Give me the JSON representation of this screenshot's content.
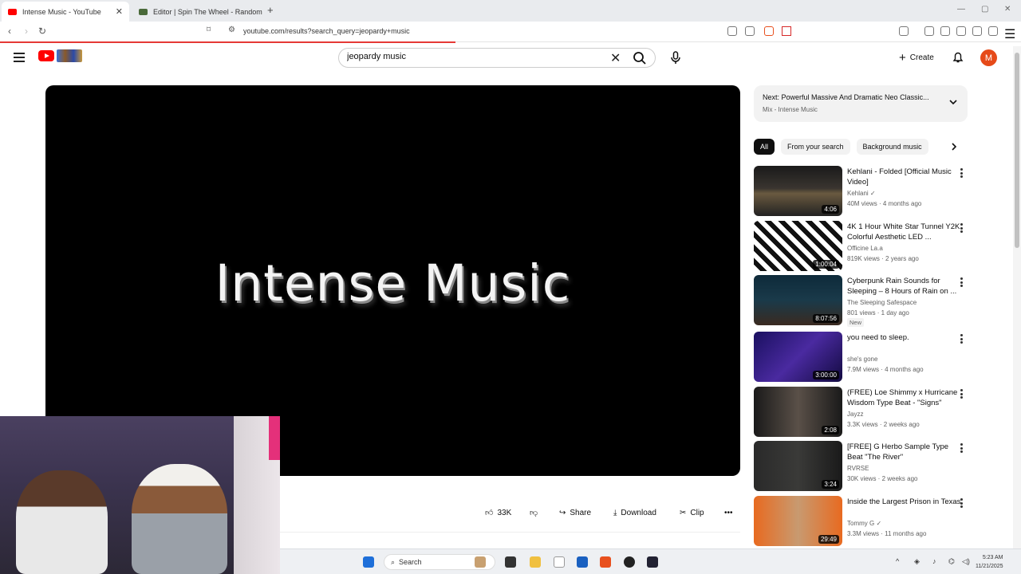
{
  "browser": {
    "tabs": [
      {
        "title": "Intense Music - YouTube",
        "active": true,
        "favicon_color": "#ff0000"
      },
      {
        "title": "Editor | Spin The Wheel - Random Pi",
        "active": false,
        "favicon_color": "#4a6a3a"
      }
    ],
    "address": "youtube.com/results?search_query=jeopardy+music"
  },
  "header": {
    "search_value": "jeopardy music",
    "create_label": "Create",
    "avatar_letter": "M"
  },
  "player": {
    "title_text": "Intense Music"
  },
  "actions": {
    "like_count": "33K",
    "share_label": "Share",
    "download_label": "Download",
    "clip_label": "Clip"
  },
  "next_up": {
    "title": "Next: Powerful Massive And Dramatic Neo Classic...",
    "subtitle": "Mix - Intense Music"
  },
  "chips": [
    "All",
    "From your search",
    "Background music"
  ],
  "recommendations": [
    {
      "title": "Kehlani - Folded [Official Music Video]",
      "channel": "Kehlani",
      "verified": true,
      "meta": "40M views · 4 months ago",
      "duration": "4:06",
      "badge": "",
      "thumb": "linear-gradient(180deg,#1a1a1a 0%,#3a3530 45%,#6a5a40 55%,#222 100%)"
    },
    {
      "title": "4K 1 Hour White Star Tunnel Y2K Colorful Aesthetic LED ...",
      "channel": "Officine La.a",
      "verified": false,
      "meta": "819K views · 2 years ago",
      "duration": "1:00:04",
      "badge": "",
      "thumb": "repeating-linear-gradient(45deg,#fff 0 6px,#111 6px 12px)"
    },
    {
      "title": "Cyberpunk Rain Sounds for Sleeping – 8 Hours of Rain on ...",
      "channel": "The Sleeping Safespace",
      "verified": false,
      "meta": "801 views · 1 day ago",
      "duration": "8:07:56",
      "badge": "New",
      "thumb": "linear-gradient(180deg,#0e2a3a 0%,#1a3a4a 50%,#3a2a20 100%)"
    },
    {
      "title": "you need to sleep.",
      "channel": "she's gone",
      "verified": false,
      "meta": "7.9M views · 4 months ago",
      "duration": "3:00:00",
      "badge": "",
      "thumb": "linear-gradient(135deg,#1a1060 0%,#4a2aa0 50%,#120a40 100%)"
    },
    {
      "title": "(FREE) Loe Shimmy x Hurricane Wisdom Type Beat - \"Signs\"",
      "channel": "Jayzz",
      "verified": false,
      "meta": "3.3K views · 2 weeks ago",
      "duration": "2:08",
      "badge": "",
      "thumb": "linear-gradient(90deg,#1a1a1a 0%,#5a5048 50%,#1a1a1a 100%)"
    },
    {
      "title": "[FREE] G Herbo Sample Type Beat \"The River\"",
      "channel": "RVRSE",
      "verified": false,
      "meta": "30K views · 2 weeks ago",
      "duration": "3:24",
      "badge": "",
      "thumb": "linear-gradient(90deg,#2a2a2a 0%,#3a3a38 50%,#1a1a1a 100%)"
    },
    {
      "title": "Inside the Largest Prison in Texas",
      "channel": "Tommy G",
      "verified": true,
      "meta": "3.3M views · 11 months ago",
      "duration": "29:49",
      "badge": "",
      "thumb": "linear-gradient(90deg,#e86a20 0%,#c89a70 50%,#e86a20 100%)"
    }
  ],
  "taskbar": {
    "search_label": "Search",
    "time": "5:23 AM",
    "date": "11/21/2025"
  },
  "colors": {
    "brand": "#ff0000",
    "avatar": "#e64a19",
    "chip_selected": "#0f0f0f"
  }
}
